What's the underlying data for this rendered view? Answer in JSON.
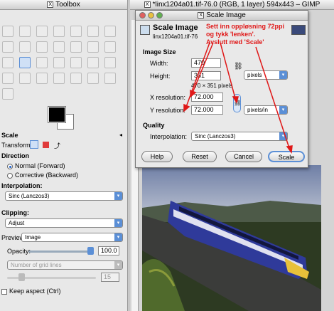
{
  "toolbox": {
    "title": "Toolbox",
    "scale_section": "Scale",
    "transform_label": "Transform:",
    "direction_label": "Direction",
    "direction_options": [
      "Normal (Forward)",
      "Corrective (Backward)"
    ],
    "interpolation_label": "Interpolation:",
    "interpolation_value": "Sinc (Lanczos3)",
    "clipping_label": "Clipping:",
    "clipping_value": "Adjust",
    "preview_label": "Preview:",
    "preview_value": "Image",
    "opacity_label": "Opacity:",
    "opacity_value": "100.0",
    "grid_lines_placeholder": "Number of grid lines",
    "grid_lines_value": "15",
    "keep_aspect_label": "Keep aspect  (Ctrl)"
  },
  "image_window": {
    "title": "*linx1204a01.tif-76.0 (RGB, 1 layer) 594x443 – GIMP"
  },
  "dialog": {
    "title": "Scale Image",
    "heading": "Scale Image",
    "subheading": "linx1204a01.tif-76",
    "image_size_label": "Image Size",
    "width_label": "Width:",
    "width_value": "470",
    "height_label": "Height:",
    "height_value": "351",
    "size_note": "470 × 351 pixels",
    "size_unit": "pixels",
    "x_res_label": "X resolution:",
    "x_res_value": "72.000",
    "y_res_label": "Y resolution:",
    "y_res_value": "72.000",
    "res_unit": "pixels/in",
    "quality_label": "Quality",
    "interp_label": "Interpolation:",
    "interp_value": "Sinc (Lanczos3)",
    "buttons": {
      "help": "Help",
      "reset": "Reset",
      "cancel": "Cancel",
      "scale": "Scale"
    }
  },
  "annotation": {
    "lines": [
      "Sett inn oppløsning 72ppi",
      "og tykk 'lenken'.",
      "Avslutt med 'Scale'"
    ]
  },
  "colors": {
    "annotation": "#e01818",
    "accent": "#5b8fd6"
  }
}
